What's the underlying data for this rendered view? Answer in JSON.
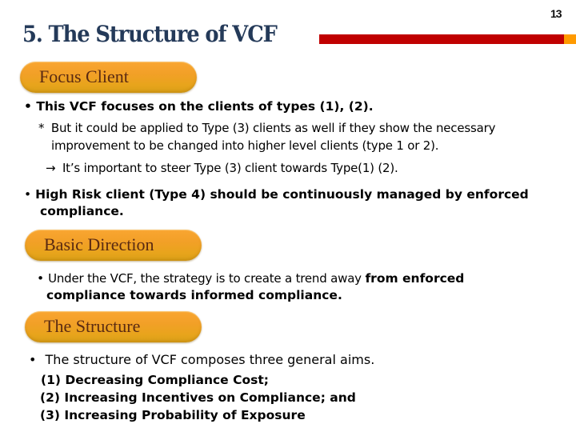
{
  "page": {
    "number": "13",
    "title": "5. The Structure of VCF",
    "colors": {
      "title": "#243a59",
      "accent_bar": "#c00000",
      "accent_bar_end": "#ff9a00",
      "pill": "#f2a027",
      "pill_text": "#5a2a12"
    }
  },
  "sections": {
    "focus_client": {
      "heading": "Focus Client",
      "bullet1": "This VCF focuses on the clients of types (1), (2).",
      "note_marker": "*",
      "note_line1": "But it could be applied to Type (3) clients as well if they show the necessary",
      "note_line2": "improvement to be changed into higher level clients (type 1 or 2).",
      "arrow_marker": "→",
      "arrow_text": "It’s important to steer Type (3) client towards Type(1) (2).",
      "bullet2_line1": "High Risk client (Type 4) should be continuously managed by enforced",
      "bullet2_line2": "compliance."
    },
    "basic_direction": {
      "heading": "Basic Direction",
      "bullet_plain": "Under the VCF, the strategy is to create a trend away ",
      "bullet_bold": "from enforced",
      "bullet_line2": "compliance towards informed compliance."
    },
    "the_structure": {
      "heading": "The Structure",
      "bullet": "The structure of VCF composes three general aims.",
      "aims": [
        "(1) Decreasing Compliance Cost;",
        "(2) Increasing Incentives on Compliance; and",
        "(3) Increasing Probability of Exposure"
      ]
    }
  },
  "markers": {
    "bullet": "•"
  }
}
